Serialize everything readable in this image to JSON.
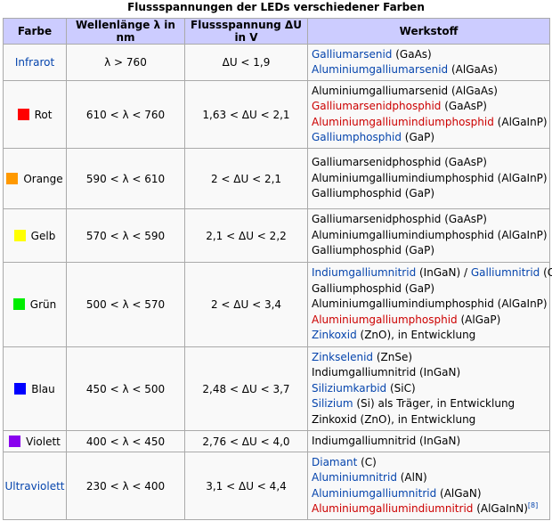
{
  "caption": "Flussspannungen der LEDs verschiedener Farben",
  "headers": [
    "Farbe",
    "Wellenlänge λ in nm",
    "Flussspannung ΔU in V",
    "Werkstoff"
  ],
  "rows": [
    {
      "farbe": "Infrarot",
      "farbe_link": true,
      "swatch": null,
      "wellenlaenge": "λ > 760",
      "spannung": "ΔU < 1,9",
      "werkstoff": [
        [
          {
            "t": "Galliumarsenid",
            "c": "bl"
          },
          {
            "t": " (GaAs)",
            "c": ""
          }
        ],
        [
          {
            "t": "Aluminiumgalliumarsenid",
            "c": "bl"
          },
          {
            "t": " (AlGaAs)",
            "c": ""
          }
        ]
      ]
    },
    {
      "farbe": "Rot",
      "farbe_link": false,
      "swatch": "#ff0000",
      "wellenlaenge": "610 < λ < 760",
      "spannung": "1,63 < ΔU < 2,1",
      "werkstoff": [
        [
          {
            "t": "Aluminiumgalliumarsenid (AlGaAs)",
            "c": ""
          }
        ],
        [
          {
            "t": "Galliumarsenidphosphid",
            "c": "rd"
          },
          {
            "t": " (GaAsP)",
            "c": ""
          }
        ],
        [
          {
            "t": "Aluminiumgalliumindiumphosphid",
            "c": "rd"
          },
          {
            "t": " (AlGaInP)",
            "c": ""
          }
        ],
        [
          {
            "t": "Galliumphosphid",
            "c": "bl"
          },
          {
            "t": " (GaP)",
            "c": ""
          }
        ]
      ]
    },
    {
      "farbe": "Orange",
      "farbe_link": false,
      "swatch": "#ff9900",
      "wellenlaenge": "590 < λ < 610",
      "spannung": "2 < ΔU < 2,1",
      "werkstoff": [
        [
          {
            "t": "Galliumarsenidphosphid (GaAsP)",
            "c": ""
          }
        ],
        [
          {
            "t": "Aluminiumgalliumindiumphosphid (AlGaInP)",
            "c": ""
          }
        ],
        [
          {
            "t": "Galliumphosphid (GaP)",
            "c": ""
          }
        ]
      ]
    },
    {
      "farbe": "Gelb",
      "farbe_link": false,
      "swatch": "#ffff00",
      "wellenlaenge": "570 < λ < 590",
      "spannung": "2,1 < ΔU < 2,2",
      "werkstoff": [
        [
          {
            "t": "Galliumarsenidphosphid (GaAsP)",
            "c": ""
          }
        ],
        [
          {
            "t": "Aluminiumgalliumindiumphosphid (AlGaInP)",
            "c": ""
          }
        ],
        [
          {
            "t": "Galliumphosphid (GaP)",
            "c": ""
          }
        ]
      ]
    },
    {
      "farbe": "Grün",
      "farbe_link": false,
      "swatch": "#00ee00",
      "wellenlaenge": "500 < λ < 570",
      "spannung": "2 < ΔU < 3,4",
      "werkstoff": [
        [
          {
            "t": "Indiumgalliumnitrid",
            "c": "bl"
          },
          {
            "t": " (InGaN) / ",
            "c": ""
          },
          {
            "t": "Galliumnitrid",
            "c": "bl"
          },
          {
            "t": " (GaN)",
            "c": ""
          }
        ],
        [
          {
            "t": "Galliumphosphid (GaP)",
            "c": ""
          }
        ],
        [
          {
            "t": "Aluminiumgalliumindiumphosphid (AlGaInP)",
            "c": ""
          }
        ],
        [
          {
            "t": "Aluminiumgalliumphosphid",
            "c": "rd"
          },
          {
            "t": " (AlGaP)",
            "c": ""
          }
        ],
        [
          {
            "t": "Zinkoxid",
            "c": "bl"
          },
          {
            "t": " (ZnO), in Entwicklung",
            "c": ""
          }
        ]
      ]
    },
    {
      "farbe": "Blau",
      "farbe_link": false,
      "swatch": "#0000ff",
      "wellenlaenge": "450 < λ < 500",
      "spannung": "2,48 < ΔU < 3,7",
      "werkstoff": [
        [
          {
            "t": "Zinkselenid",
            "c": "bl"
          },
          {
            "t": " (ZnSe)",
            "c": ""
          }
        ],
        [
          {
            "t": "Indiumgalliumnitrid (InGaN)",
            "c": ""
          }
        ],
        [
          {
            "t": "Siliziumkarbid",
            "c": "bl"
          },
          {
            "t": " (SiC)",
            "c": ""
          }
        ],
        [
          {
            "t": "Silizium",
            "c": "bl"
          },
          {
            "t": " (Si) als Träger, in Entwicklung",
            "c": ""
          }
        ],
        [
          {
            "t": "Zinkoxid (ZnO), in Entwicklung",
            "c": ""
          }
        ]
      ]
    },
    {
      "farbe": "Violett",
      "farbe_link": false,
      "swatch": "#8800ee",
      "wellenlaenge": "400 < λ < 450",
      "spannung": "2,76 < ΔU < 4,0",
      "werkstoff": [
        [
          {
            "t": "Indiumgalliumnitrid (InGaN)",
            "c": ""
          }
        ]
      ]
    },
    {
      "farbe": "Ultraviolett",
      "farbe_link": true,
      "swatch": null,
      "wellenlaenge": "230 < λ < 400",
      "spannung": "3,1 < ΔU < 4,4",
      "werkstoff": [
        [
          {
            "t": "Diamant",
            "c": "bl"
          },
          {
            "t": " (C)",
            "c": ""
          }
        ],
        [
          {
            "t": "Aluminiumnitrid",
            "c": "bl"
          },
          {
            "t": " (AlN)",
            "c": ""
          }
        ],
        [
          {
            "t": "Aluminiumgalliumnitrid",
            "c": "bl"
          },
          {
            "t": " (AlGaN)",
            "c": ""
          }
        ],
        [
          {
            "t": "Aluminiumgalliumindiumnitrid",
            "c": "rd"
          },
          {
            "t": " (AlGaInN)",
            "c": ""
          },
          {
            "t": "[8]",
            "c": "bl",
            "sup": true
          }
        ]
      ]
    }
  ],
  "row_heights": [
    41,
    76,
    68,
    60,
    95,
    94,
    24,
    76
  ]
}
